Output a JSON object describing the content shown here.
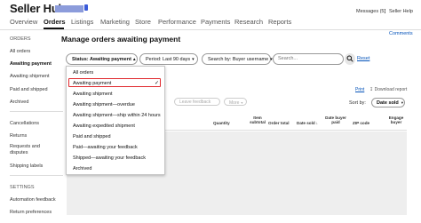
{
  "header": {
    "title": "Seller Hub",
    "messages": "Messages (5)",
    "separator": "|",
    "seller_help": "Seller Help"
  },
  "nav": {
    "tabs": [
      "Overview",
      "Orders",
      "Listings",
      "Marketing",
      "Store",
      "Performance",
      "Payments",
      "Research",
      "Reports"
    ],
    "active": "Orders"
  },
  "comments_link": "Comments",
  "sidebar": {
    "orders_heading": "ORDERS",
    "items": [
      "All orders",
      "Awaiting payment",
      "Awaiting shipment",
      "Paid and shipped",
      "Archived"
    ],
    "active": "Awaiting payment",
    "items2": [
      "Cancellations",
      "Returns",
      "Requests and disputes",
      "Shipping labels"
    ],
    "settings_heading": "SETTINGS",
    "settings_items": [
      "Automation feedback",
      "Return preferences"
    ]
  },
  "page_title": "Manage orders awaiting payment",
  "filters": {
    "status": "Status: Awaiting payment",
    "period": "Period: Last 90 days",
    "search_by": "Search by: Buyer username",
    "search_placeholder": "Search...",
    "reset": "Reset"
  },
  "status_dropdown": {
    "options": [
      "All orders",
      "Awaiting payment",
      "Awaiting shipment",
      "Awaiting shipment—overdue",
      "Awaiting shipment—ship within 24 hours",
      "Awaiting expedited shipment",
      "Paid and shipped",
      "Paid—awaiting your feedback",
      "Shipped—awaiting your feedback",
      "Archived"
    ],
    "selected": "Awaiting payment",
    "check": "✓"
  },
  "actions": {
    "leave_feedback": "Leave feedback",
    "more": "More",
    "print": "Print",
    "download_report": "Download report"
  },
  "sort": {
    "label": "Sort by:",
    "value": "Date sold"
  },
  "table": {
    "headers": [
      "Quantity",
      "Item subtotal",
      "Order total",
      "Date buyer paid",
      "ZIP code",
      "Engage buyer"
    ],
    "date_sold_header": "Date sold"
  }
}
